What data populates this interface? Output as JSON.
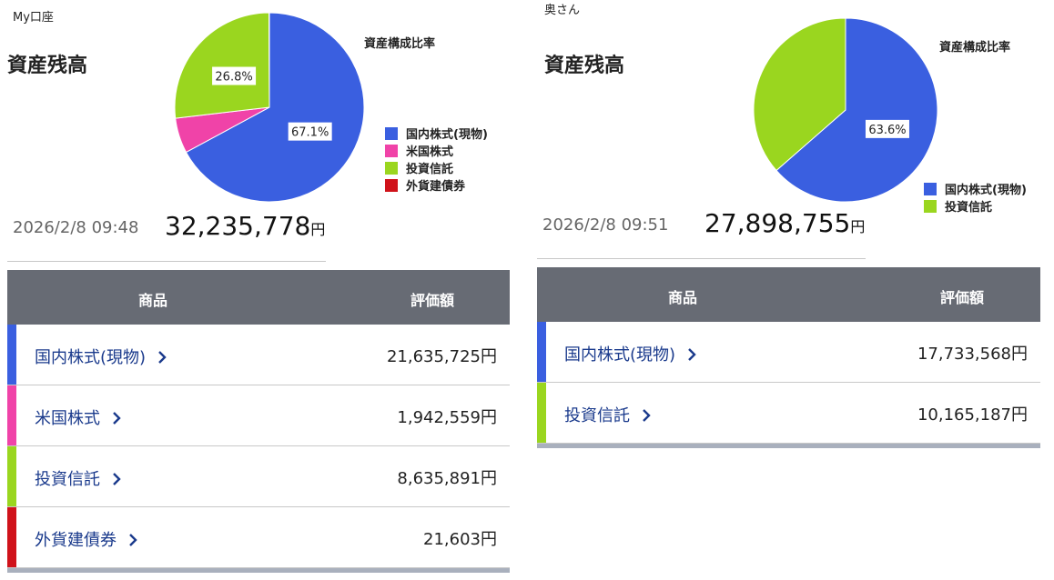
{
  "panels": [
    {
      "account": "My口座",
      "heading": "資産残高",
      "ratio_title": "資産構成比率",
      "datetime": "2026/2/8 09:48",
      "total": "32,235,778",
      "yen": "円",
      "table": {
        "col_product": "商品",
        "col_value": "評価額",
        "rows": [
          {
            "name": "国内株式(現物)",
            "value": "21,635,725円",
            "color": "#3a5fe0"
          },
          {
            "name": "米国株式",
            "value": "1,942,559円",
            "color": "#f043a8"
          },
          {
            "name": "投資信託",
            "value": "8,635,891円",
            "color": "#9ad61f"
          },
          {
            "name": "外貨建債券",
            "value": "21,603円",
            "color": "#d0121a"
          }
        ]
      },
      "legend": [
        {
          "label": "国内株式(現物)",
          "color": "#3a5fe0"
        },
        {
          "label": "米国株式",
          "color": "#f043a8"
        },
        {
          "label": "投資信託",
          "color": "#9ad61f"
        },
        {
          "label": "外貨建債券",
          "color": "#d0121a"
        }
      ],
      "chart_data": {
        "type": "pie",
        "categories": [
          "国内株式(現物)",
          "米国株式",
          "投資信託",
          "外貨建債券"
        ],
        "values": [
          21635725,
          1942559,
          8635891,
          21603
        ],
        "colors": [
          "#3a5fe0",
          "#f043a8",
          "#9ad61f",
          "#d0121a"
        ],
        "data_labels": [
          "67.1%",
          "",
          "26.8%",
          ""
        ],
        "title": "資産構成比率",
        "legend": "right"
      }
    },
    {
      "account": "奥さん",
      "heading": "資産残高",
      "ratio_title": "資産構成比率",
      "datetime": "2026/2/8 09:51",
      "total": "27,898,755",
      "yen": "円",
      "table": {
        "col_product": "商品",
        "col_value": "評価額",
        "rows": [
          {
            "name": "国内株式(現物)",
            "value": "17,733,568円",
            "color": "#3a5fe0"
          },
          {
            "name": "投資信託",
            "value": "10,165,187円",
            "color": "#9ad61f"
          }
        ]
      },
      "legend": [
        {
          "label": "国内株式(現物)",
          "color": "#3a5fe0"
        },
        {
          "label": "投資信託",
          "color": "#9ad61f"
        }
      ],
      "chart_data": {
        "type": "pie",
        "categories": [
          "国内株式(現物)",
          "投資信託"
        ],
        "values": [
          17733568,
          10165187
        ],
        "colors": [
          "#3a5fe0",
          "#9ad61f"
        ],
        "data_labels": [
          "63.6%",
          ""
        ],
        "title": "資産構成比率",
        "legend": "right"
      }
    }
  ]
}
